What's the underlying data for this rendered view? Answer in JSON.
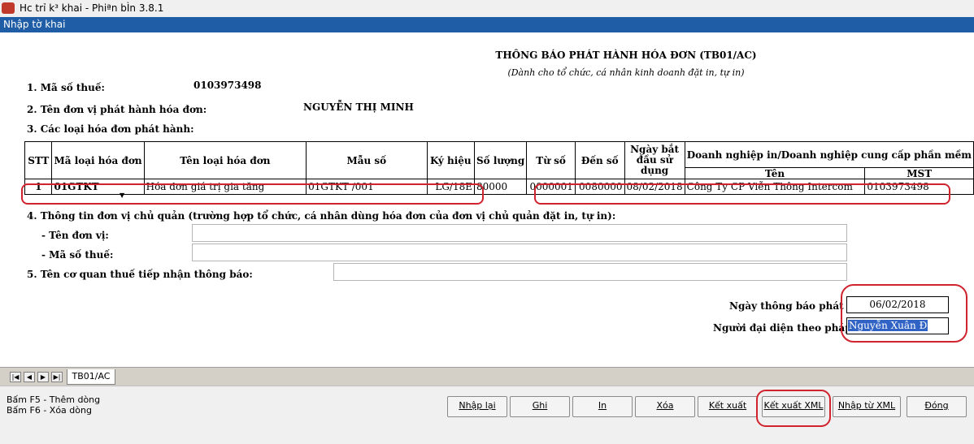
{
  "window": {
    "title": "Hc trỉ k³ khai - Phiªn bÌn 3.8.1",
    "form_name": "Nhập tờ khai"
  },
  "document": {
    "title": "THÔNG BÁO PHÁT HÀNH HÓA ĐƠN (TB01/AC)",
    "subtitle": "(Dành cho tổ chức, cá nhân kinh doanh đặt in, tự in)",
    "tax_code_label": "1. Mã số thuế:",
    "tax_code_value": "0103973498",
    "issuer_label": "2. Tên đơn vị phát hành hóa đơn:",
    "issuer_value": "NGUYỄN THỊ MINH",
    "types_label": "3. Các loại hóa đơn phát hành:",
    "section4_label": "4. Thông tin đơn vị chủ quản (trường hợp tổ chức, cá nhân dùng hóa đơn của đơn vị chủ quản đặt in, tự in):",
    "unit_name_label": "- Tên đơn vị:",
    "unit_tax_label": "- Mã số thuế:",
    "section5_label": "5. Tên cơ quan thuế tiếp nhận thông báo:",
    "notice_date_label": "Ngày thông báo phát hành",
    "notice_date_value": "06/02/2018",
    "rep_label": "Người đại diện theo pháp luật",
    "rep_value": "Nguyễn Xuân Đ"
  },
  "table": {
    "headers": {
      "stt": "STT",
      "ma_loai": "Mã loại hóa đơn",
      "ten_loai": "Tên loại hóa đơn",
      "mau_so": "Mẫu số",
      "ky_hieu": "Ký hiệu",
      "so_luong": "Số lượng",
      "tu_so": "Từ số",
      "den_so": "Đến số",
      "ngay_bat_dau": "Ngày bắt đầu sử dụng",
      "dn_in": "Doanh nghiệp in/Doanh nghiệp cung cấp phần mềm",
      "ten": "Tên",
      "mst": "MST"
    },
    "rows": [
      {
        "stt": "1",
        "ma_loai": "01GTKT",
        "ten_loai": "Hóa đơn giá trị gia tăng",
        "mau_so": "01GTKT /001",
        "ky_hieu": "LG/18E",
        "so_luong": "80000",
        "tu_so": "0000001",
        "den_so": "0080000",
        "ngay_bat_dau": "08/02/2018",
        "ten": "Công Ty CP Viễn Thông Intercom",
        "mst": "0103973498"
      }
    ]
  },
  "sheet_tab": "TB01/AC",
  "hints": [
    "Bấm F5 - Thêm dòng",
    "Bấm F6 - Xóa dòng"
  ],
  "buttons": {
    "nhap_lai": "Nhập lại",
    "ghi": "Ghi",
    "in": "In",
    "xoa": "Xóa",
    "ket_xuat": "Kết xuất",
    "ket_xuat_xml": "Kết xuất XML",
    "nhap_tu_xml": "Nhập từ XML",
    "dong": "Đóng"
  },
  "colors": {
    "highlight": "#d0232e",
    "selection": "#3163c5",
    "titlebar": "#1f5ea7"
  }
}
